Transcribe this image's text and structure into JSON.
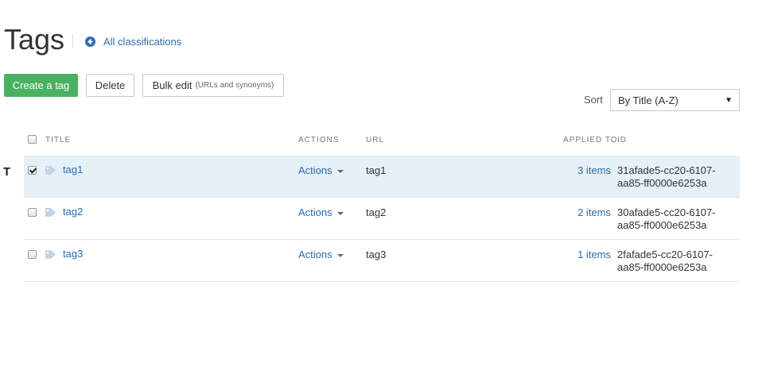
{
  "header": {
    "title": "Tags",
    "back_link": "All classifications"
  },
  "toolbar": {
    "create_label": "Create a tag",
    "delete_label": "Delete",
    "bulk_edit_label": "Bulk edit",
    "bulk_edit_sub": "(URLs and synonyms)"
  },
  "sort": {
    "label": "Sort",
    "selected": "By Title (A-Z)"
  },
  "table": {
    "columns": [
      "TITLE",
      "ACTIONS",
      "URL",
      "APPLIED TO",
      "ID"
    ],
    "row_marker": "T",
    "rows": [
      {
        "title": "tag1",
        "actions": "Actions",
        "url": "tag1",
        "applied": "3 items",
        "id_line1": "31afade5-cc20-6107-",
        "id_line2": "aa85-ff0000e6253a",
        "checked": true
      },
      {
        "title": "tag2",
        "actions": "Actions",
        "url": "tag2",
        "applied": "2 items",
        "id_line1": "30afade5-cc20-6107-",
        "id_line2": "aa85-ff0000e6253a",
        "checked": false
      },
      {
        "title": "tag3",
        "actions": "Actions",
        "url": "tag3",
        "applied": "1 items",
        "id_line1": "2fafade5-cc20-6107-",
        "id_line2": "aa85-ff0000e6253a",
        "checked": false
      }
    ]
  },
  "colors": {
    "primary": "#4bb162",
    "link": "#2b6cb0",
    "selected_row": "#e6f0f7"
  }
}
